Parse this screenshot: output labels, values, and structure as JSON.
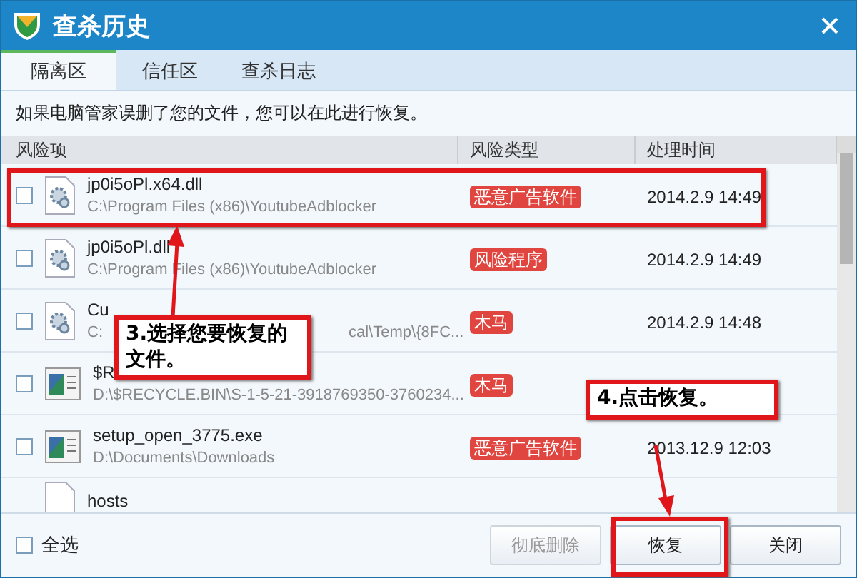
{
  "window": {
    "title": "查杀历史"
  },
  "tabs": [
    {
      "label": "隔离区",
      "selected": true
    },
    {
      "label": "信任区",
      "selected": false
    },
    {
      "label": "查杀日志",
      "selected": false
    }
  ],
  "info_text": "如果电脑管家误删了您的文件，您可以在此进行恢复。",
  "table": {
    "columns": [
      "风险项",
      "风险类型",
      "处理时间"
    ],
    "rows": [
      {
        "kind": "gear-file",
        "checked": false,
        "name": "jp0i5oPl.x64.dll",
        "path": [
          "C:\\Program Files (x86)\\YoutubeAdblocker"
        ],
        "type": "恶意广告软件",
        "time": "2014.2.9 14:49"
      },
      {
        "kind": "gear-file",
        "checked": false,
        "name": "jp0i5oPl.dll",
        "path": [
          "C:\\Program Files (x86)\\YoutubeAdblocker"
        ],
        "type": "风险程序",
        "time": "2014.2.9 14:49"
      },
      {
        "kind": "gear-file",
        "checked": false,
        "name": "Cu",
        "path": [
          "C:",
          "cal\\Temp\\{8FC..."
        ],
        "type": "木马",
        "time": "2014.2.9 14:48"
      },
      {
        "kind": "window-file",
        "checked": false,
        "name": "$R",
        "path": [
          "D:\\$RECYCLE.BIN\\S-1-5-21-3918769350-3760234..."
        ],
        "type": "木马"
      },
      {
        "kind": "window-file",
        "checked": false,
        "name": "setup_open_3775.exe",
        "path": [
          "D:\\Documents\\Downloads"
        ],
        "type": "恶意广告软件",
        "time": "2013.12.9 12:03"
      },
      {
        "kind": "blank-file",
        "name": "hosts"
      }
    ]
  },
  "footer": {
    "select_all": {
      "label": "全选",
      "checked": false
    },
    "buttons": [
      {
        "label": "彻底删除",
        "disabled": true
      },
      {
        "label": "恢复",
        "disabled": false
      },
      {
        "label": "关闭",
        "disabled": false
      }
    ]
  },
  "annotations": [
    {
      "kind": "callout",
      "text": "3.选择您要恢复的文件。"
    },
    {
      "kind": "callout",
      "text": "4.点击恢复。"
    }
  ]
}
